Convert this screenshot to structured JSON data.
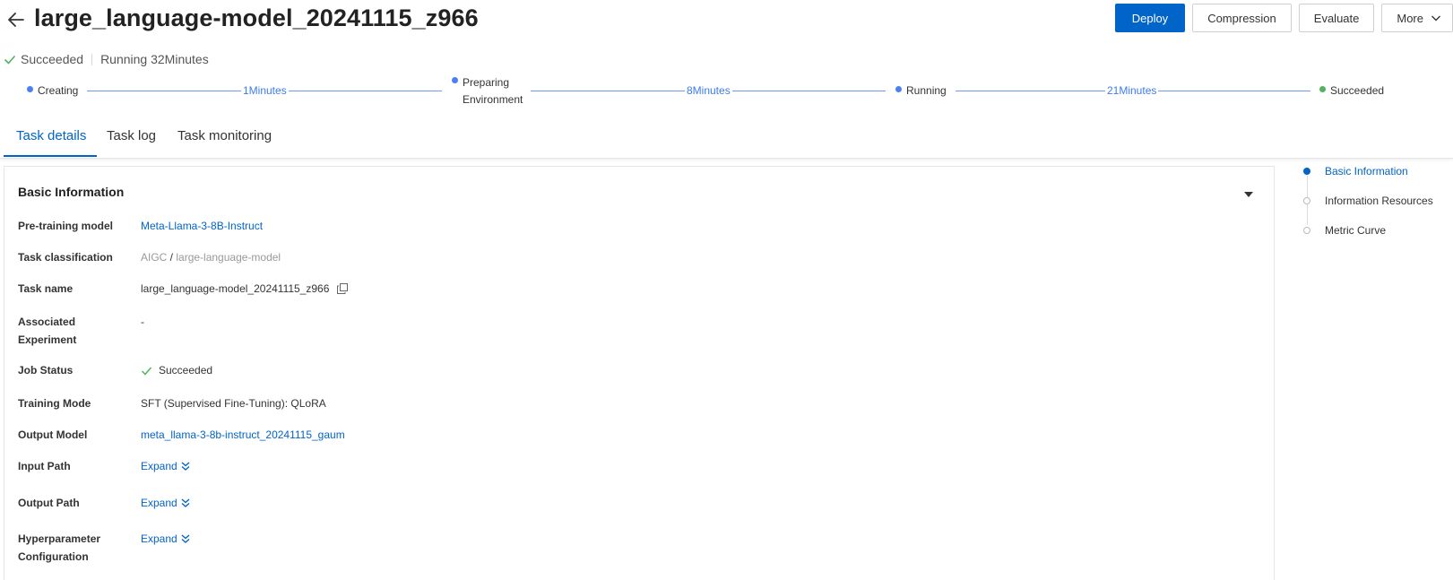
{
  "header": {
    "title": "large_language-model_20241115_z966",
    "actions": {
      "deploy": "Deploy",
      "compression": "Compression",
      "evaluate": "Evaluate",
      "more": "More"
    }
  },
  "status": {
    "state": "Succeeded",
    "running": "Running 32Minutes"
  },
  "steps": [
    {
      "label": "Creating"
    },
    {
      "label_line1": "Preparing",
      "label_line2": "Environment"
    },
    {
      "label": "Running"
    },
    {
      "label": "Succeeded"
    }
  ],
  "durations": [
    "1Minutes",
    "8Minutes",
    "21Minutes"
  ],
  "tabs": [
    {
      "label": "Task details",
      "active": true
    },
    {
      "label": "Task log"
    },
    {
      "label": "Task monitoring"
    }
  ],
  "basic_info": {
    "title": "Basic Information",
    "rows": {
      "pretraining_model": {
        "label": "Pre-training model",
        "value": "Meta-Llama-3-8B-Instruct"
      },
      "task_classification": {
        "label": "Task classification",
        "part1": "AIGC",
        "sep": " / ",
        "part2": "large-language-model"
      },
      "task_name": {
        "label": "Task name",
        "value": "large_language-model_20241115_z966"
      },
      "associated_experiment": {
        "label_line1": "Associated",
        "label_line2": "Experiment",
        "value": "-"
      },
      "job_status": {
        "label": "Job Status",
        "value": "Succeeded"
      },
      "training_mode": {
        "label": "Training Mode",
        "value": "SFT (Supervised Fine-Tuning): QLoRA"
      },
      "output_model": {
        "label": "Output Model",
        "value": "meta_llama-3-8b-instruct_20241115_gaum"
      },
      "input_path": {
        "label": "Input Path",
        "value": "Expand"
      },
      "output_path": {
        "label": "Output Path",
        "value": "Expand"
      },
      "hyperparameter": {
        "label_line1": "Hyperparameter",
        "label_line2": "Configuration",
        "value": "Expand"
      }
    }
  },
  "anchor_nav": [
    {
      "label": "Basic Information",
      "active": true
    },
    {
      "label": "Information Resources"
    },
    {
      "label": "Metric Curve"
    }
  ],
  "colors": {
    "primary": "#0064c8",
    "success": "#52b35e",
    "progress": "#4a7ff5"
  }
}
